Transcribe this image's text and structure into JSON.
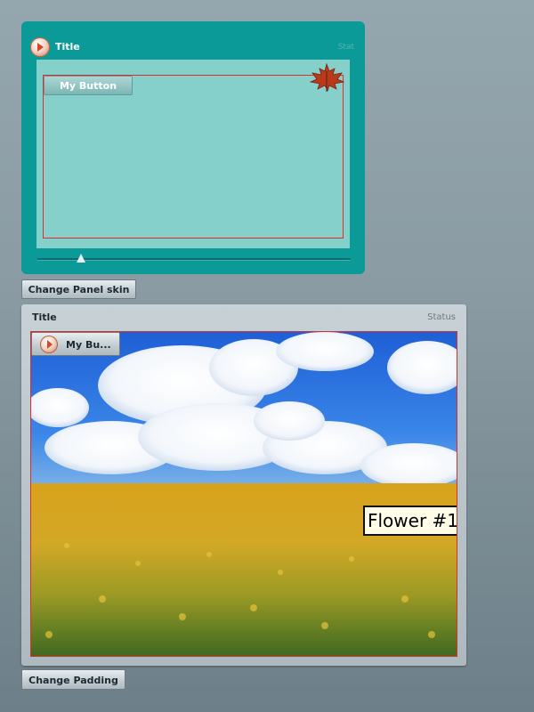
{
  "panel1": {
    "title": "Title",
    "status": "Stat",
    "button_label": "My Button",
    "slider_value_percent": 14
  },
  "change_skin_label": "Change Panel skin",
  "panel2": {
    "title": "Title",
    "status": "Status",
    "button_label": "My Bu...",
    "image_caption": "Flower #1"
  },
  "change_padding_label": "Change Padding",
  "colors": {
    "teal_panel": "#0c9a98",
    "teal_content": "#86d0cc",
    "content_border": "#d9302a",
    "grey_panel": "#b8c3c9"
  }
}
